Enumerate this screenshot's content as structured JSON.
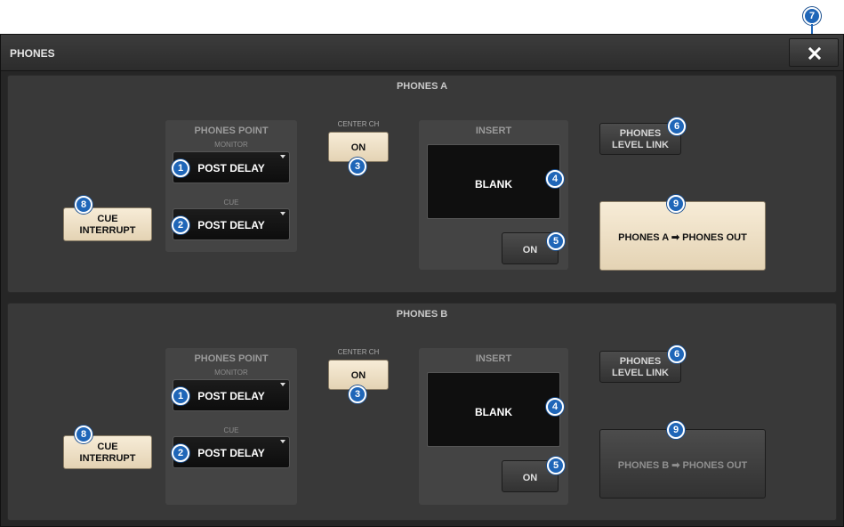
{
  "window": {
    "title": "PHONES"
  },
  "colors": {
    "badge": "#1f66b8",
    "button_on": "#f2e6cf",
    "panel": "#393939"
  },
  "sections": [
    {
      "title": "PHONES A",
      "phones_point": {
        "title": "PHONES POINT",
        "monitor_label": "MONITOR",
        "monitor_value": "POST DELAY",
        "cue_label": "CUE",
        "cue_value": "POST DELAY"
      },
      "center_ch": {
        "label": "CENTER CH",
        "button": "ON",
        "active": true
      },
      "insert": {
        "title": "INSERT",
        "slot": "BLANK",
        "on_button": "ON",
        "on_active": false
      },
      "level_link": {
        "line1": "PHONES",
        "line2": "LEVEL LINK"
      },
      "cue_interrupt": {
        "line1": "CUE",
        "line2": "INTERRUPT"
      },
      "route_button": {
        "label": "PHONES A ➡ PHONES OUT",
        "active": true
      }
    },
    {
      "title": "PHONES B",
      "phones_point": {
        "title": "PHONES POINT",
        "monitor_label": "MONITOR",
        "monitor_value": "POST DELAY",
        "cue_label": "CUE",
        "cue_value": "POST DELAY"
      },
      "center_ch": {
        "label": "CENTER CH",
        "button": "ON",
        "active": true
      },
      "insert": {
        "title": "INSERT",
        "slot": "BLANK",
        "on_button": "ON",
        "on_active": false
      },
      "level_link": {
        "line1": "PHONES",
        "line2": "LEVEL LINK"
      },
      "cue_interrupt": {
        "line1": "CUE",
        "line2": "INTERRUPT"
      },
      "route_button": {
        "label": "PHONES B ➡ PHONES OUT",
        "active": false
      }
    }
  ],
  "callouts": {
    "monitor": "1",
    "cue": "2",
    "center_ch": "3",
    "insert_slot": "4",
    "insert_on": "5",
    "level_link": "6",
    "close": "7",
    "cue_interrupt": "8",
    "route": "9"
  }
}
